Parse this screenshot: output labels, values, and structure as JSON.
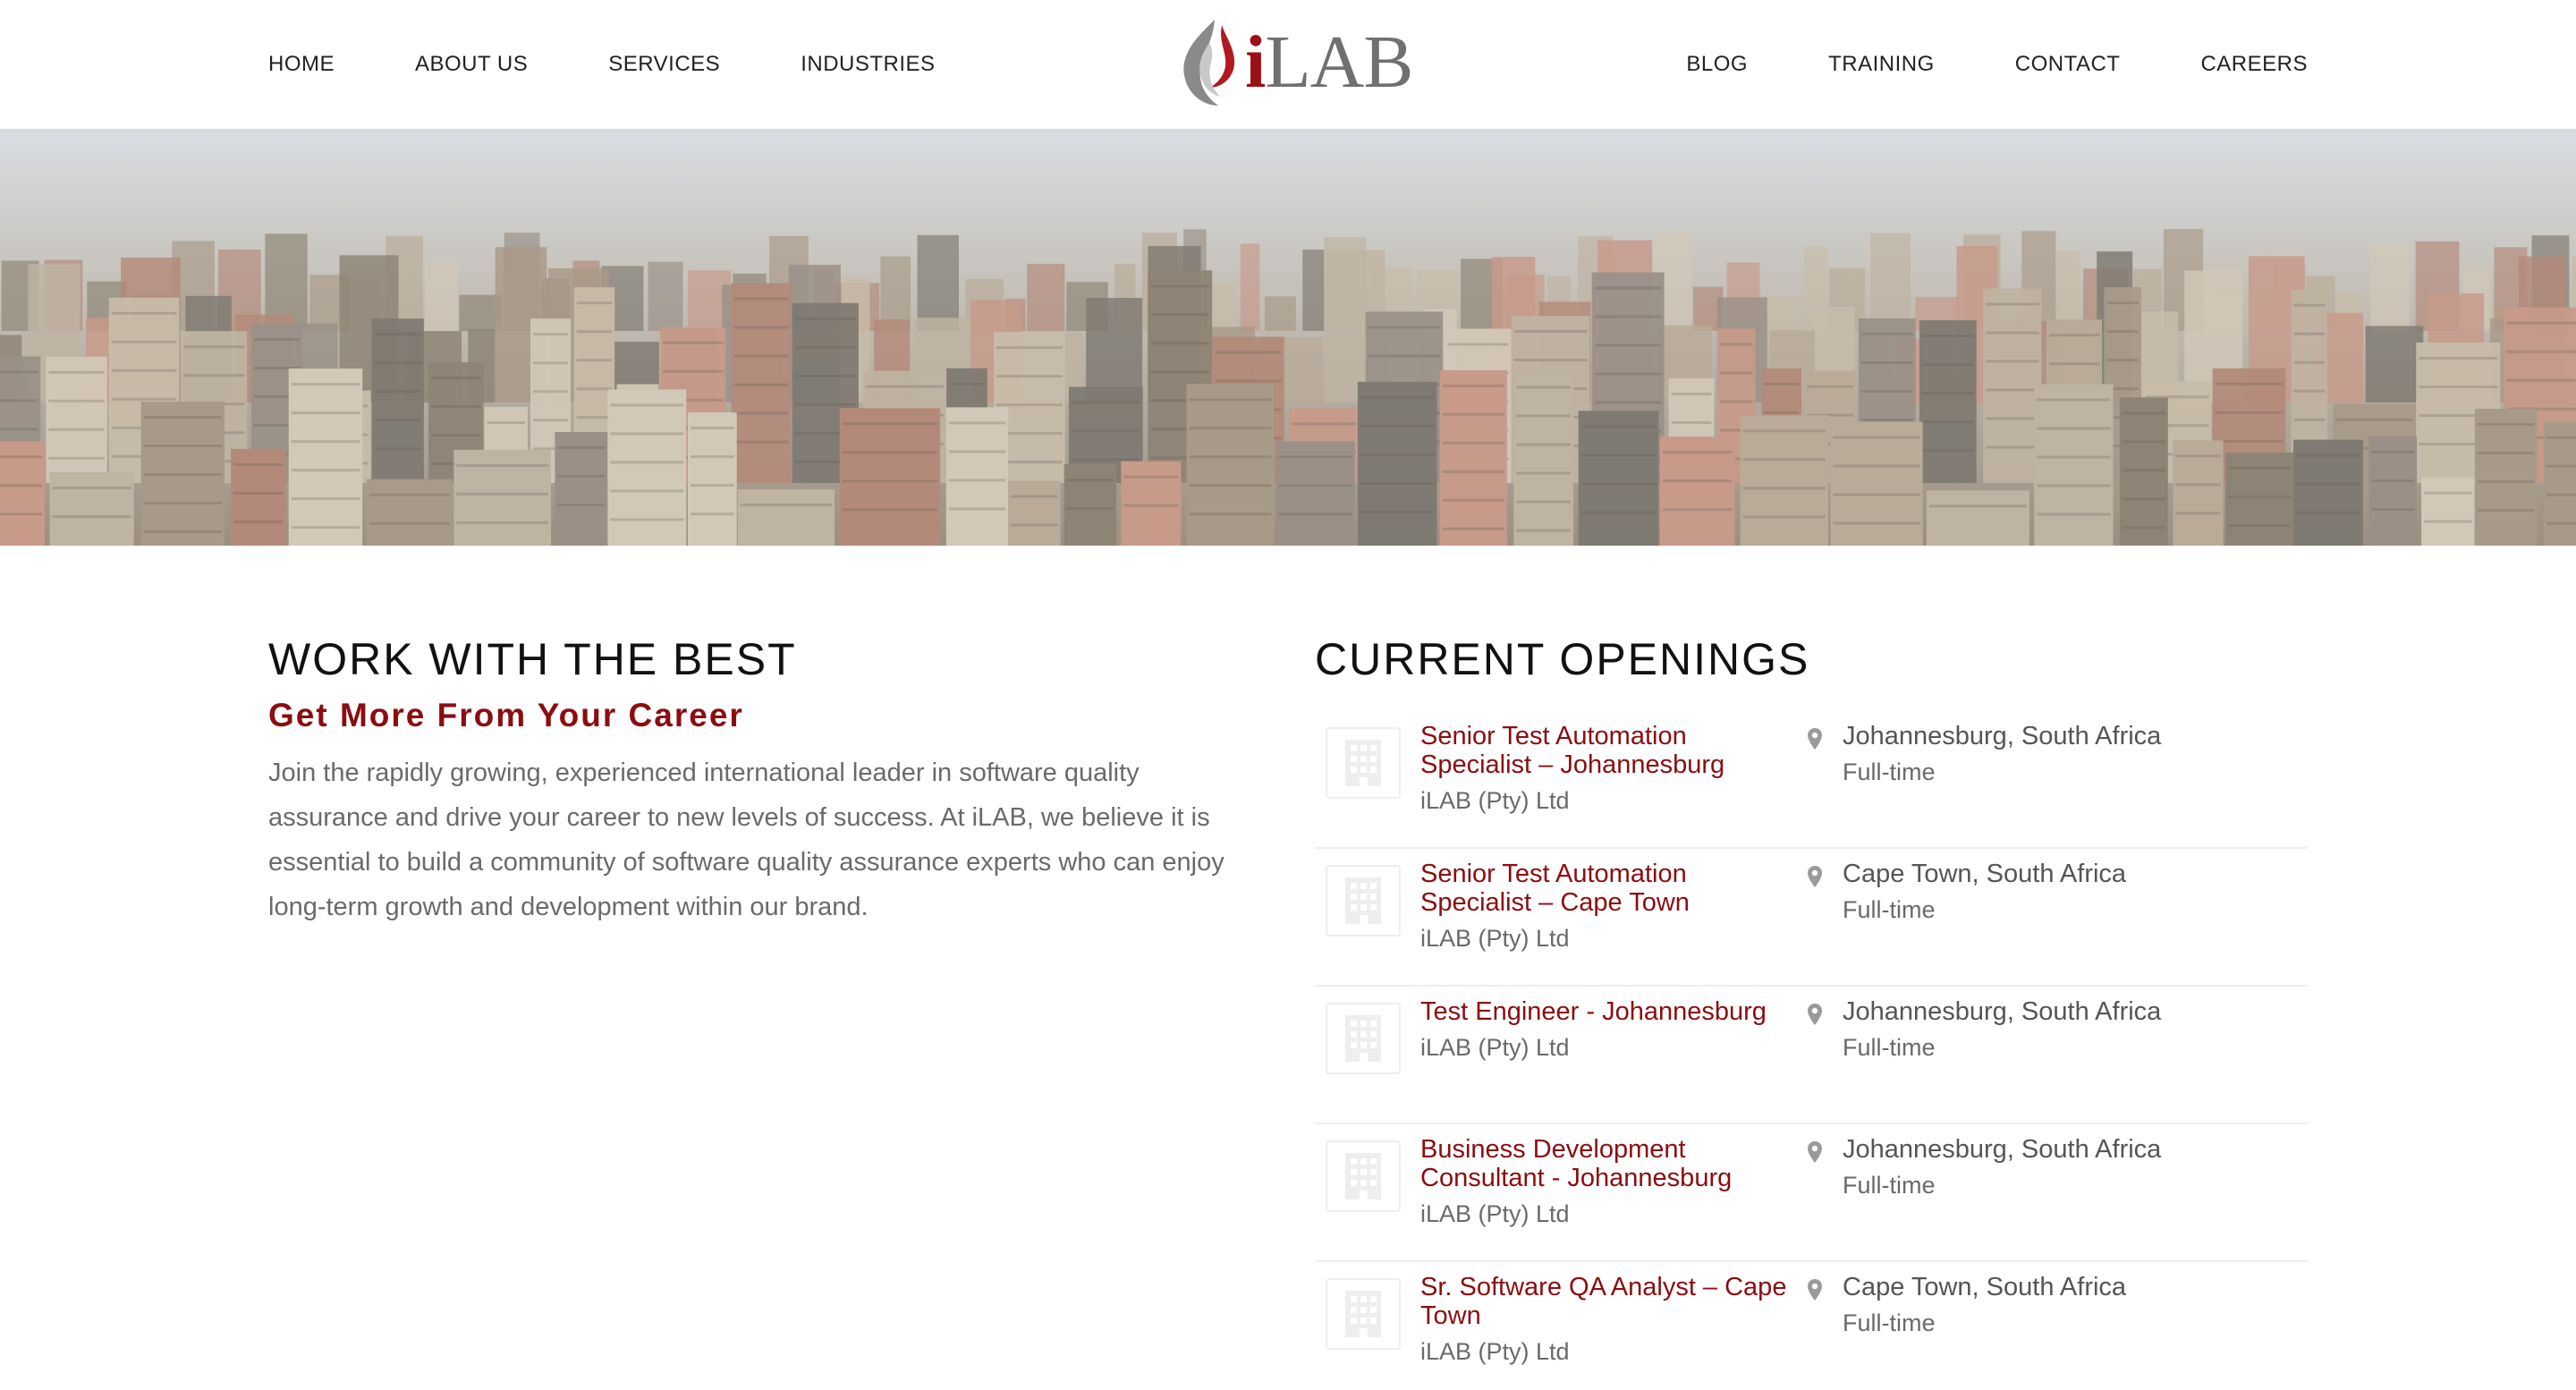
{
  "nav": {
    "left": [
      "HOME",
      "ABOUT US",
      "SERVICES",
      "INDUSTRIES"
    ],
    "right": [
      "BLOG",
      "TRAINING",
      "CONTACT",
      "CAREERS"
    ]
  },
  "logo": {
    "i": "i",
    "lab": "LAB",
    "icon": "flame-logo-icon"
  },
  "hero": {
    "icon": "city-skyline-image"
  },
  "intro": {
    "heading": "WORK WITH THE BEST",
    "subheading": "Get More From Your Career",
    "body": "Join the rapidly growing, experienced international leader in software quality assurance and drive your career to new levels of success.  At iLAB, we believe it is essential to build a community of software quality assurance experts who can enjoy long-term growth and development within our brand."
  },
  "openings": {
    "heading": "CURRENT OPENINGS",
    "jobs": [
      {
        "title": "Senior Test Automation Specialist – Johannesburg",
        "company": "iLAB (Pty) Ltd",
        "location": "Johannesburg, South Africa",
        "type": "Full-time"
      },
      {
        "title": "Senior Test Automation Specialist – Cape Town",
        "company": "iLAB (Pty) Ltd",
        "location": "Cape Town, South Africa",
        "type": "Full-time"
      },
      {
        "title": "Test Engineer - Johannesburg",
        "company": "iLAB (Pty) Ltd",
        "location": "Johannesburg, South Africa",
        "type": "Full-time"
      },
      {
        "title": "Business Development Consultant - Johannesburg",
        "company": "iLAB (Pty) Ltd",
        "location": "Johannesburg, South Africa",
        "type": "Full-time"
      },
      {
        "title": "Sr. Software QA Analyst – Cape Town",
        "company": "iLAB (Pty) Ltd",
        "location": "Cape Town, South Africa",
        "type": "Full-time"
      }
    ]
  },
  "colors": {
    "brand_red": "#8b0d10",
    "text_gray": "#6a6a6a"
  }
}
